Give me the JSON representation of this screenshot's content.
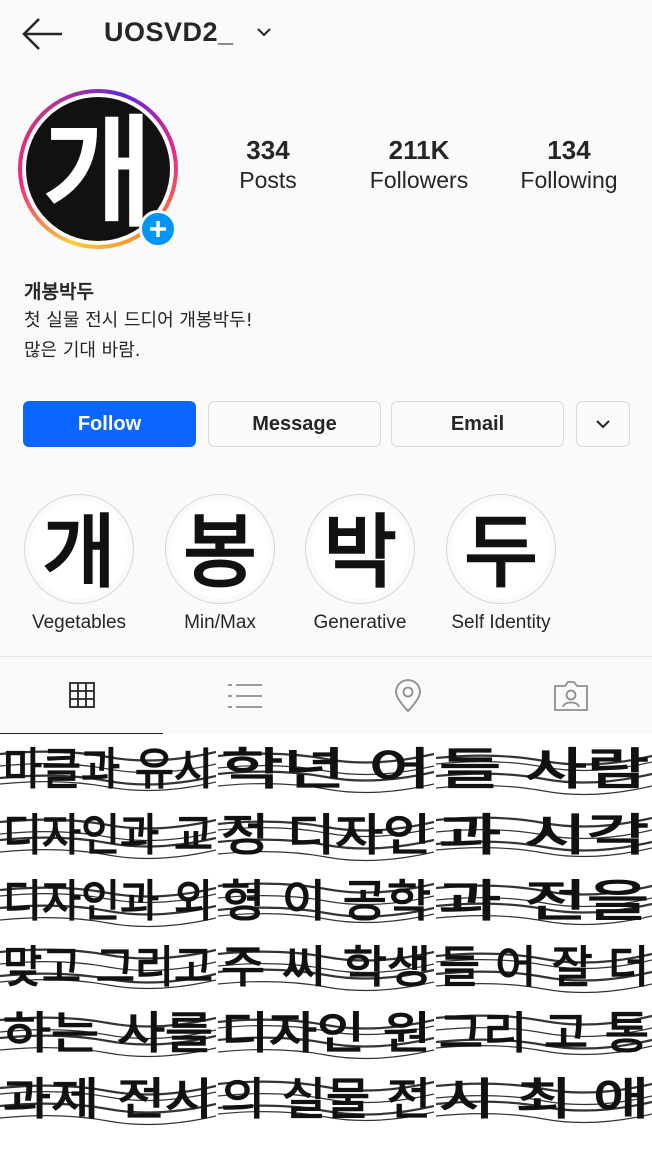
{
  "header": {
    "username": "UOSVD2_",
    "back_icon": "arrow-left-icon",
    "dropdown_icon": "chevron-down-icon"
  },
  "profile": {
    "avatar_text": "개",
    "stats": [
      {
        "value": "334",
        "label": "Posts"
      },
      {
        "value": "211K",
        "label": "Followers"
      },
      {
        "value": "134",
        "label": "Following"
      }
    ],
    "name": "개봉박두",
    "bio_lines": [
      "첫 실물 전시 드디어 개봉박두!",
      "많은 기대 바람."
    ]
  },
  "actions": {
    "follow": "Follow",
    "message": "Message",
    "email": "Email",
    "more_icon": "chevron-down-icon"
  },
  "highlights": [
    {
      "glyph": "개",
      "label": "Vegetables"
    },
    {
      "glyph": "봉",
      "label": "Min/Max"
    },
    {
      "glyph": "박",
      "label": "Generative"
    },
    {
      "glyph": "두",
      "label": "Self Identity"
    }
  ],
  "tabs": [
    {
      "icon": "grid-icon"
    },
    {
      "icon": "list-icon"
    },
    {
      "icon": "location-pin-icon"
    },
    {
      "icon": "tagged-person-icon"
    }
  ],
  "grid": {
    "cells": [
      {
        "lines": [
          "마클과 유시",
          "디자인과 교",
          "디자인과 외",
          "맞고 그리고",
          "하는 사를",
          "과제 전시"
        ]
      },
      {
        "lines": [
          "학년 어",
          "정 디자인",
          "형 이 공학",
          "주 씨 학생",
          "디자인 원",
          "의 실물 전"
        ]
      },
      {
        "lines": [
          "들 사람",
          "과 시각",
          "과 전을",
          "들 어 잘 더",
          "그리 고 통",
          "시 최 애"
        ]
      }
    ]
  }
}
